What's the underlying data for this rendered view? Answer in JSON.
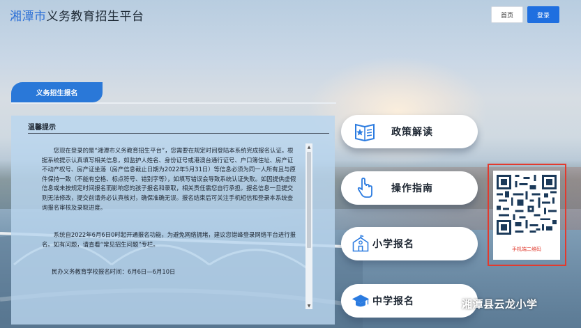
{
  "header": {
    "logo_city": "湘潭市",
    "logo_rest": "义务教育招生平台",
    "home_label": "首页",
    "login_label": "登录"
  },
  "section_tab": {
    "label": "义务招生报名"
  },
  "notice": {
    "title": "温馨提示",
    "paragraphs": [
      "您现在登录的是“湘潭市义务教育招生平台”，您需要在规定时间登陆本系统完成报名认证。根据系统提示认真填写相关信息，如监护人姓名、身份证号或港澳台通行证号、户口簿住址、房产证不动产权号、房产证坐落（房产信息截止日期为2022年5月31日）等信息必须为同一人所有且与原件保持一致（不能有空格、标点符号、错别字等），如填写错误会导致系统认证失败。如因提供虚假信息或未按规定时间报名而影响您的孩子报名和录取，相关责任需您自行承担。报名信息一旦提交则无法修改，提交前请务必认真核对，确保准确无误。报名结束后可关注手机短信和登录本系统查询报名审核及录取进度。",
      "系统自2022年6月6日0时起开通报名功能，为避免网络拥堵，建议您错峰登录网络平台进行报名。如有问题，请查看“常见招生问题”专栏。",
      "民办义务教育学校报名时间：6月6日—6月10日"
    ]
  },
  "menu": [
    {
      "label": "政策解读",
      "icon": "policy-book-star-icon"
    },
    {
      "label": "操作指南",
      "icon": "hand-pointer-icon"
    },
    {
      "label": "小学报名",
      "icon": "school-building-icon"
    },
    {
      "label": "中学报名",
      "icon": "graduation-cap-icon"
    }
  ],
  "qr": {
    "caption": "手机端二维码"
  },
  "watermark": {
    "text": "湘潭县云龙小学",
    "icon": "wechat-icon"
  },
  "colors": {
    "accent": "#2a78d8",
    "login_button": "#1f6fe0",
    "qr_border": "#e23a2e",
    "menu_icon": "#2b7be0"
  }
}
